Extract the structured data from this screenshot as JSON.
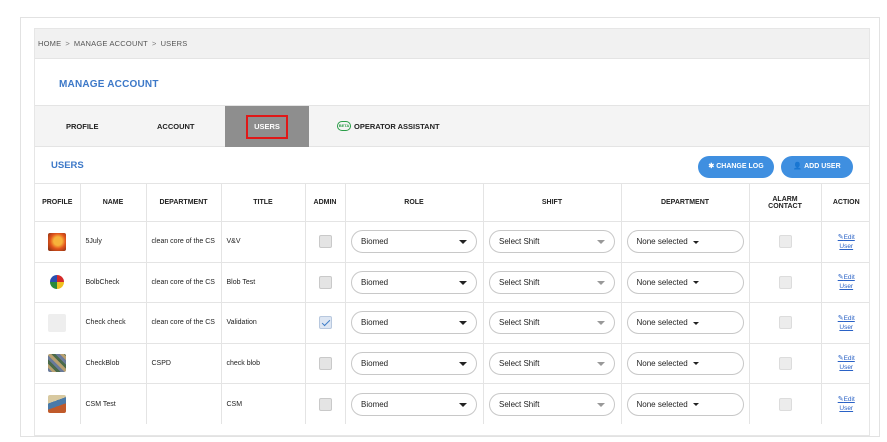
{
  "breadcrumb": {
    "home": "HOME",
    "manage": "MANAGE ACCOUNT",
    "users": "USERS",
    "separator": ">"
  },
  "page_title": "MANAGE ACCOUNT",
  "tabs": [
    {
      "label": "PROFILE"
    },
    {
      "label": "ACCOUNT"
    },
    {
      "label": "USERS",
      "active": true
    },
    {
      "label": "OPERATOR ASSISTANT",
      "badge": "BETA"
    }
  ],
  "users_section": {
    "title": "USERS",
    "change_log_label": "CHANGE LOG",
    "add_user_label": "ADD USER"
  },
  "table": {
    "headers": {
      "profile": "PROFILE",
      "name": "NAME",
      "department": "DEPARTMENT",
      "title": "TITLE",
      "admin": "ADMIN",
      "role": "ROLE",
      "shift": "SHIFT",
      "department2": "DEPARTMENT",
      "alarm_line1": "ALARM",
      "alarm_line2": "CONTACT",
      "action": "ACTION"
    },
    "rows": [
      {
        "name": "5July",
        "department": "clean core of the CS",
        "title": "V&V",
        "admin": false,
        "role": "Biomed",
        "shift": "Select Shift",
        "dept_select": "None selected",
        "action_line1": "Edit",
        "action_line2": "User",
        "thumb": "orange-photo"
      },
      {
        "name": "BolbCheck",
        "department": "clean core of the CS",
        "title": "Blob Test",
        "admin": false,
        "role": "Biomed",
        "shift": "Select Shift",
        "dept_select": "None selected",
        "action_line1": "Edit",
        "action_line2": "User",
        "thumb": "colorful-cube"
      },
      {
        "name": "Check check",
        "department": "clean core of the CS",
        "title": "Validation",
        "admin": true,
        "role": "Biomed",
        "shift": "Select Shift",
        "dept_select": "None selected",
        "action_line1": "Edit",
        "action_line2": "User",
        "thumb": "default-avatar"
      },
      {
        "name": "CheckBlob",
        "department": "CSPD",
        "title": "check blob",
        "admin": false,
        "role": "Biomed",
        "shift": "Select Shift",
        "dept_select": "None selected",
        "action_line1": "Edit",
        "action_line2": "User",
        "thumb": "mosaic-photo"
      },
      {
        "name": "CSM Test",
        "department": "",
        "title": "CSM",
        "admin": false,
        "role": "Biomed",
        "shift": "Select Shift",
        "dept_select": "None selected",
        "action_line1": "Edit",
        "action_line2": "User",
        "thumb": "landscape-photo"
      }
    ]
  },
  "colors": {
    "accent": "#3c78c8",
    "button": "#3f8fe0",
    "active_tab": "#8e8e8e",
    "highlight": "#e01818"
  }
}
